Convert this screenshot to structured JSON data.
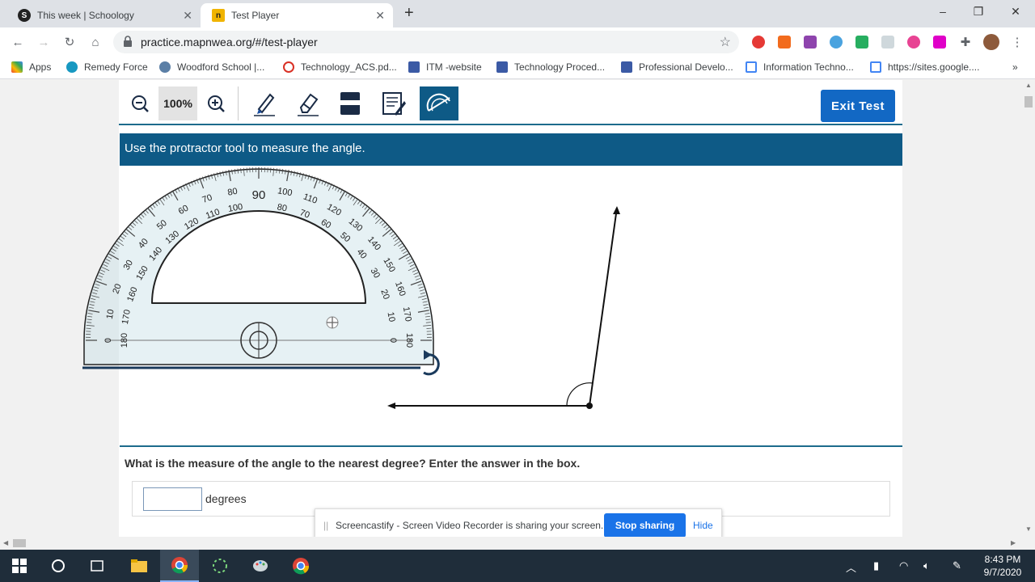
{
  "browser": {
    "tabs": [
      {
        "title": "This week | Schoology",
        "favicon": "S"
      },
      {
        "title": "Test Player",
        "favicon": "n"
      }
    ],
    "new_tab": "+",
    "url": "practice.mapnwea.org/#/test-player"
  },
  "bookmarks": [
    {
      "label": "Apps"
    },
    {
      "label": "Remedy Force"
    },
    {
      "label": "Woodford School |..."
    },
    {
      "label": "Technology_ACS.pd..."
    },
    {
      "label": "ITM -website"
    },
    {
      "label": "Technology Proced..."
    },
    {
      "label": "Professional Develo..."
    },
    {
      "label": "Information Techno..."
    },
    {
      "label": "https://sites.google...."
    }
  ],
  "test_toolbar": {
    "zoom_level": "100%",
    "exit_label": "Exit Test"
  },
  "question": {
    "header": "Use the protractor tool to measure the angle.",
    "prompt": "What is the measure of the angle to the nearest degree? Enter the answer in the box.",
    "answer_value": "",
    "unit_label": "degrees"
  },
  "protractor": {
    "center_label": "90",
    "outer_labels": [
      "0",
      "10",
      "20",
      "30",
      "40",
      "50",
      "60",
      "70",
      "80",
      "100",
      "110",
      "120",
      "130",
      "140",
      "150",
      "160",
      "170",
      "180"
    ],
    "inner_labels": [
      "180",
      "170",
      "160",
      "150",
      "140",
      "130",
      "120",
      "110",
      "100",
      "80",
      "70",
      "60",
      "50",
      "40",
      "30",
      "20",
      "10",
      "0"
    ]
  },
  "share_bar": {
    "message": "Screencastify - Screen Video Recorder is sharing your screen.",
    "stop_label": "Stop sharing",
    "hide_label": "Hide"
  },
  "taskbar": {
    "time": "8:43 PM",
    "date": "9/7/2020"
  },
  "colors": {
    "header_blue": "#0e5a86",
    "exit_blue": "#1268c4",
    "share_blue": "#1a73e8"
  }
}
